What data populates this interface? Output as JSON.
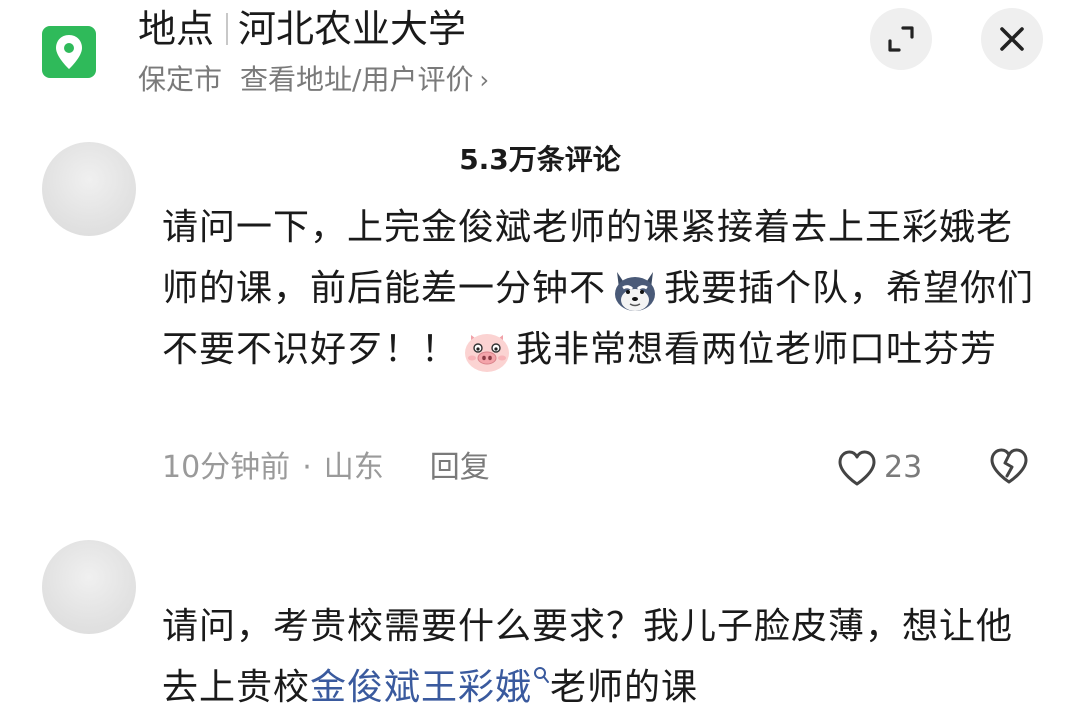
{
  "header": {
    "label": "地点",
    "place": "河北农业大学",
    "city": "保定市",
    "action": "查看地址/用户评价"
  },
  "comments_header": {
    "count": "5.3万条评论"
  },
  "comments": [
    {
      "text_part1": "请问一下，上完金俊斌老师的课紧接着去上王彩娥老师的课，前后能差一分钟不",
      "emoji1": "husky-emoji",
      "text_part2": "我要插个队，希望你们不要不识好歹！！",
      "emoji2": "pig-emoji",
      "text_part3": "我非常想看两位老师口吐芬芳",
      "time": "10分钟前",
      "location": "山东",
      "reply_label": "回复",
      "likes": "23"
    },
    {
      "text_part1": "请问，考贵校需要什么要求？我儿子脸皮薄，想让他去上贵校",
      "link_text": "金俊斌王彩娥",
      "text_part2": "老师的课"
    }
  ],
  "colors": {
    "location_icon_bg": "#2fba5a",
    "link": "#3a5a9e",
    "meta": "#9a9a9a"
  }
}
